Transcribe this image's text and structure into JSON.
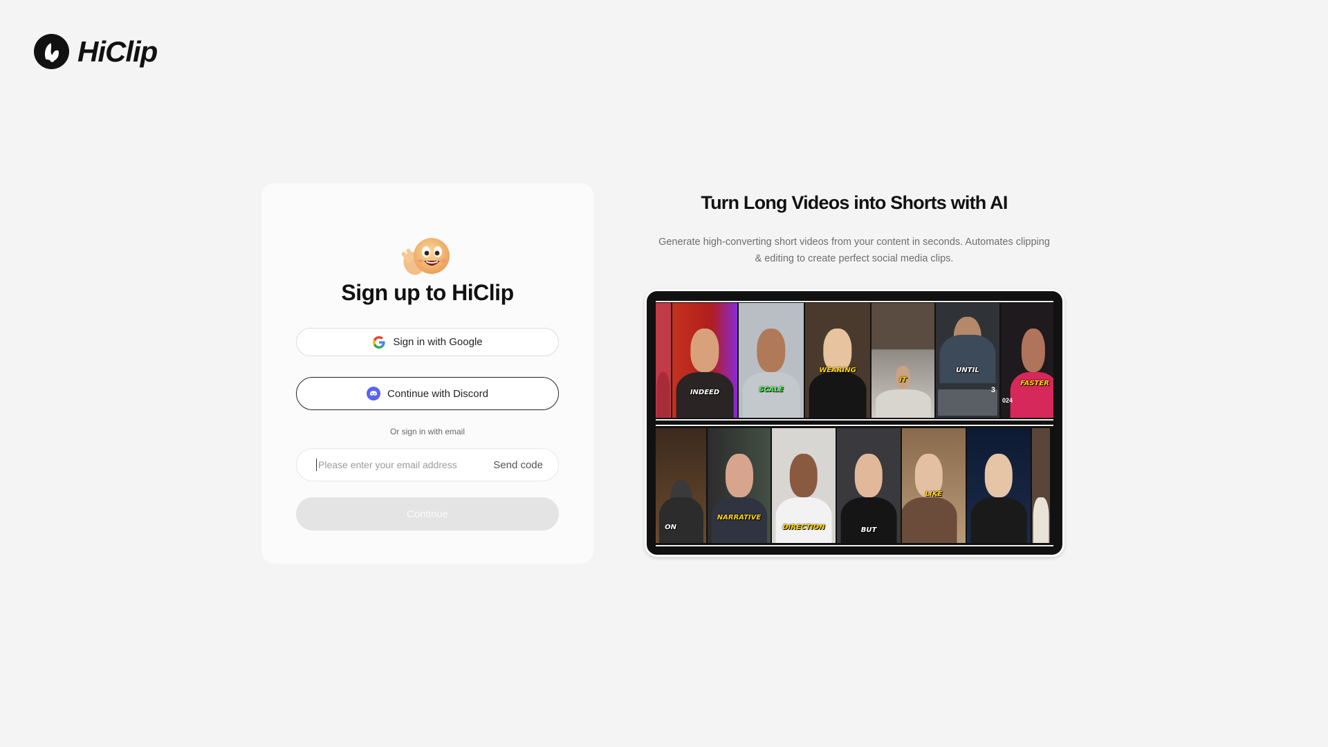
{
  "brand": {
    "name": "HiClip"
  },
  "login": {
    "title": "Sign up to HiClip",
    "google_label": "Sign in with Google",
    "discord_label": "Continue with Discord",
    "divider": "Or sign in with email",
    "email_placeholder": "Please enter your email address",
    "email_value": "",
    "send_code": "Send code",
    "continue_label": "Continue"
  },
  "promo": {
    "title": "Turn Long Videos into Shorts with AI",
    "description": "Generate high-converting short videos from your content in seconds. Automates clipping & editing to create perfect social media clips."
  },
  "clips": {
    "top": [
      {
        "caption": ""
      },
      {
        "caption": "INDEED"
      },
      {
        "caption": "SCALE"
      },
      {
        "caption": "WEARING"
      },
      {
        "caption": "IT"
      },
      {
        "caption": "UNTIL"
      },
      {
        "caption": "FASTER"
      }
    ],
    "bottom": [
      {
        "caption": "ON"
      },
      {
        "caption": "NARRATIVE"
      },
      {
        "caption": "DIRECTION"
      },
      {
        "caption": "BUT"
      },
      {
        "caption": "LIKE"
      },
      {
        "caption": ""
      },
      {
        "caption": ""
      }
    ],
    "extra_text": {
      "count": "3",
      "year": "024"
    }
  },
  "colors": {
    "background": "#f4f4f4",
    "card": "#fbfbfb",
    "discord": "#5865f2",
    "continue_disabled": "#e4e4e4"
  }
}
